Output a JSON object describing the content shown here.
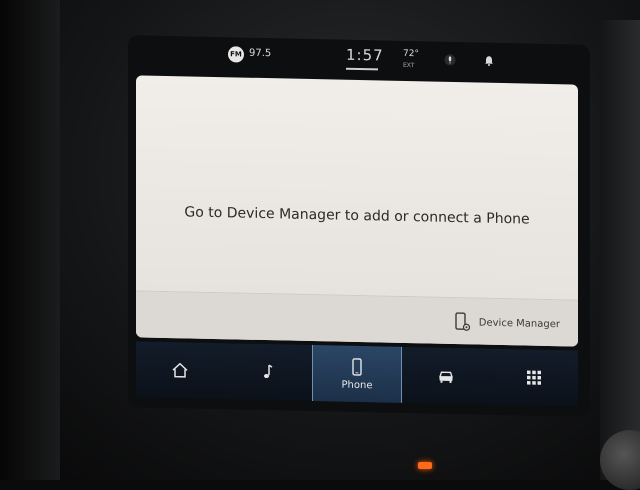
{
  "status_bar": {
    "radio_badge": "FM",
    "radio_frequency": "97.5",
    "clock": "1:57",
    "temperature": "72°",
    "temperature_label": "EXT",
    "icons": [
      "mic-icon",
      "bell-icon"
    ]
  },
  "main": {
    "message": "Go to Device Manager to add or connect a Phone",
    "device_manager_label": "Device Manager",
    "device_manager_icon": "phone-settings-icon"
  },
  "nav": {
    "items": [
      {
        "icon": "home-icon",
        "label": ""
      },
      {
        "icon": "music-note-icon",
        "label": ""
      },
      {
        "icon": "phone-icon",
        "label": "Phone",
        "active": true
      },
      {
        "icon": "car-icon",
        "label": ""
      },
      {
        "icon": "apps-grid-icon",
        "label": ""
      }
    ]
  },
  "colors": {
    "panel_bg": "#ede9e5",
    "nav_bg": "#101722",
    "nav_active": "#26405d",
    "accent_led": "#ff6a1a"
  }
}
